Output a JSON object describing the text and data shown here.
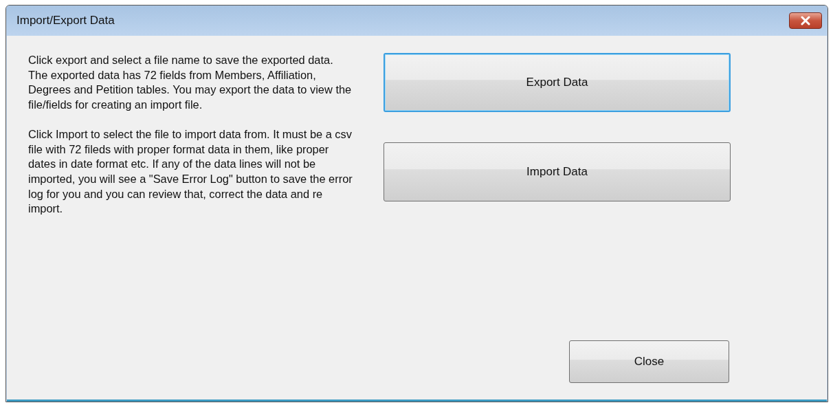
{
  "window": {
    "title": "Import/Export Data"
  },
  "paragraphs": [
    "Click export and select a file name to save the exported data. The exported data has 72 fields from Members, Affiliation, Degrees and Petition tables. You may export the data to view the file/fields for creating an import file.",
    "Click Import to select the file to import data from. It must be a csv file with 72 fileds with proper format data in them, like proper dates in date format etc. If any of the data lines will not be imported, you will see a \"Save Error Log\" button to save the error log for you and you can review that, correct the data and re import."
  ],
  "buttons": [
    {
      "label": "Export Data",
      "focused": true
    },
    {
      "label": "Import Data",
      "focused": false
    }
  ],
  "close_button": {
    "label": "Close",
    "focused": false
  }
}
